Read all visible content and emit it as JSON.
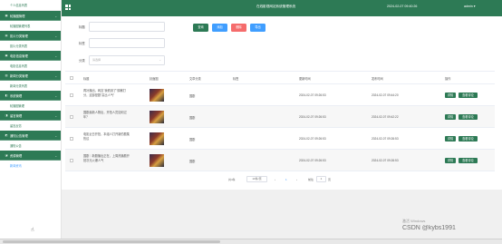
{
  "header": {
    "title": "在线影视网站系统管理系统",
    "time": "2024-02-07 09:40:26",
    "user": "admin ▾"
  },
  "sidebar": {
    "top_item": "个人信息列表",
    "groups": [
      {
        "label": "轮播图管理",
        "item": "轮播图管理列表"
      },
      {
        "label": "影片分类管理",
        "item": "影片分类列表"
      },
      {
        "label": "电影信息管理",
        "item": "电影信息列表"
      },
      {
        "label": "新闻分类管理",
        "item": "新闻分类列表"
      },
      {
        "label": "系统管理",
        "item": "轮播图管理"
      },
      {
        "label": "留言管理",
        "item": "留言反馈"
      },
      {
        "label": "通知公告管理",
        "item": "通知公告"
      },
      {
        "label": "资源管理",
        "item": "新闻资讯"
      }
    ]
  },
  "filters": {
    "title_label": "标题",
    "tag_label": "标签",
    "category_label": "分类",
    "category_placeholder": "请选择"
  },
  "buttons": {
    "query": "查询",
    "add": "添加",
    "delete": "删除",
    "export": "导出"
  },
  "table": {
    "headers": [
      "标题",
      "封面图",
      "文章分类",
      "标签",
      "更新时间",
      "发布时间",
      "操作"
    ],
    "rows": [
      {
        "title": "再补播出，网友\"我看到了\"原著打分，这部是剧\"高比人气\"",
        "category": "国剧",
        "tag": "",
        "updated": "2024-02-07 09:26:53",
        "published": "2024-02-07 09:44:20"
      },
      {
        "title": "国剧最新人物出，开拍人员如何过年？",
        "category": "国剧",
        "tag": "",
        "updated": "2024-02-07 09:26:53",
        "published": "2024-02-07 09:42:22"
      },
      {
        "title": "电影近日开拍，本组人打开新的剧集热议",
        "category": "国剧",
        "tag": "",
        "updated": "2024-02-07 09:26:53",
        "published": "2024-02-07 09:26:53"
      },
      {
        "title": "国剧｜新剧播出正在，上周热播剧开拍次元火爆人气",
        "category": "国剧",
        "tag": "",
        "updated": "2024-02-07 09:26:53",
        "published": "2024-02-07 09:26:53"
      }
    ],
    "view_btn": "详情",
    "comment_btn": "查看评论"
  },
  "pager": {
    "total": "共4条",
    "size": "10条/页",
    "page": "1",
    "goto": "前往",
    "goto_val": "1",
    "page_unit": "页"
  },
  "watermark": {
    "sub": "激活 Windows",
    "main": "CSDN @kybs1991"
  },
  "colors": {
    "brand": "#2d7a55",
    "query": "#2d7a55",
    "add": "#409eff",
    "delete": "#f56c6c",
    "export": "#409eff"
  }
}
